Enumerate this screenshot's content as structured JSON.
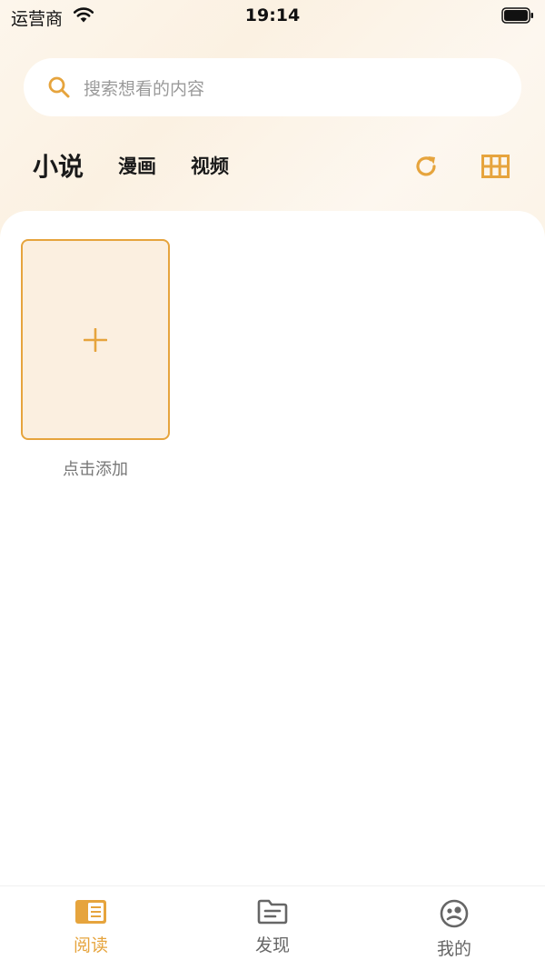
{
  "status_bar": {
    "carrier": "运营商",
    "time": "19:14"
  },
  "search": {
    "placeholder": "搜索想看的内容"
  },
  "category_tabs": [
    {
      "label": "小说",
      "active": true
    },
    {
      "label": "漫画",
      "active": false
    },
    {
      "label": "视频",
      "active": false
    }
  ],
  "shelf": {
    "add_label": "点击添加"
  },
  "bottom_tabs": [
    {
      "label": "阅读",
      "icon": "book-icon",
      "active": true
    },
    {
      "label": "发现",
      "icon": "folder-icon",
      "active": false
    },
    {
      "label": "我的",
      "icon": "profile-icon",
      "active": false
    }
  ],
  "colors": {
    "accent": "#e6a43d",
    "card_bg": "#fbefe0",
    "inactive": "#666666"
  }
}
